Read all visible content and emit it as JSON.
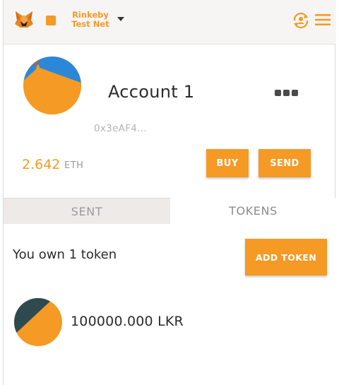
{
  "header": {
    "logo_icon": "metamask-fox-icon",
    "network": {
      "label": "Rinkeby Test Net",
      "dot_color": "#f49a25"
    },
    "account_switch_icon": "account-switch-icon",
    "menu_icon": "hamburger-menu-icon"
  },
  "account": {
    "name": "Account 1",
    "address": "0x3eAF4...",
    "balance": {
      "amount": "2.642",
      "unit": "ETH"
    },
    "more_icon": "more-options-icon"
  },
  "actions": {
    "buy_label": "BUY",
    "send_label": "SEND"
  },
  "tabs": [
    {
      "label": "SENT",
      "active": false
    },
    {
      "label": "TOKENS",
      "active": true
    }
  ],
  "tokens_section": {
    "summary": "You own 1 token",
    "add_token_label": "ADD TOKEN",
    "items": [
      {
        "balance": "100000.000 LKR"
      }
    ]
  },
  "colors": {
    "accent": "#f49a25",
    "text": "#2b2b2b",
    "muted": "#9b9b9b"
  }
}
